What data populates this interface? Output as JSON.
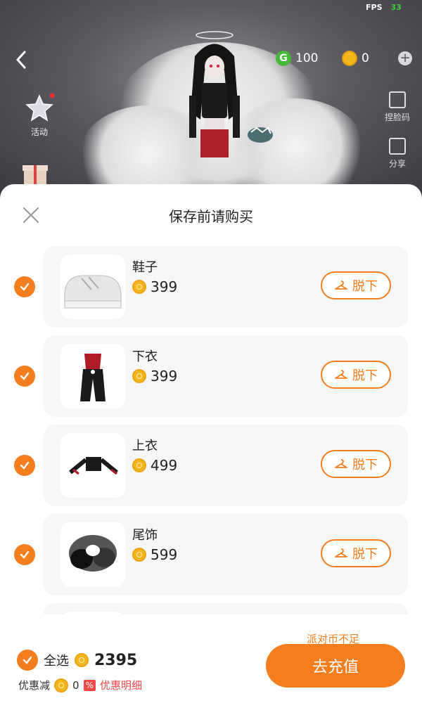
{
  "status": {
    "fps_label": "FPS",
    "fps_value": "33"
  },
  "top_bar": {
    "back_icon": "chevron-left-icon",
    "green_currency": "100",
    "gold_currency": "0",
    "plus_icon": "plus-icon"
  },
  "side_tools": [
    {
      "label": "捏脸码",
      "icon": "edit-icon"
    },
    {
      "label": "分享",
      "icon": "share-icon"
    }
  ],
  "activity": {
    "label": "活动",
    "icon": "star-badge-icon"
  },
  "sheet": {
    "title": "保存前请购买",
    "close_icon": "close-icon",
    "items": [
      {
        "name": "鞋子",
        "price": "399",
        "action": "脱下"
      },
      {
        "name": "下衣",
        "price": "399",
        "action": "脱下"
      },
      {
        "name": "上衣",
        "price": "499",
        "action": "脱下"
      },
      {
        "name": "尾饰",
        "price": "599",
        "action": "脱下"
      }
    ]
  },
  "footer": {
    "insufficient": "派对币不足",
    "select_all": "全选",
    "total": "2395",
    "discount_label": "优惠减",
    "discount_value": "0",
    "discount_badge": "%",
    "discount_detail": "优惠明细",
    "recharge": "去充值"
  },
  "colors": {
    "accent": "#f47d1e",
    "discount": "#f04848",
    "green_coin": "#46b83a",
    "gold_coin": "#f3b51c"
  }
}
